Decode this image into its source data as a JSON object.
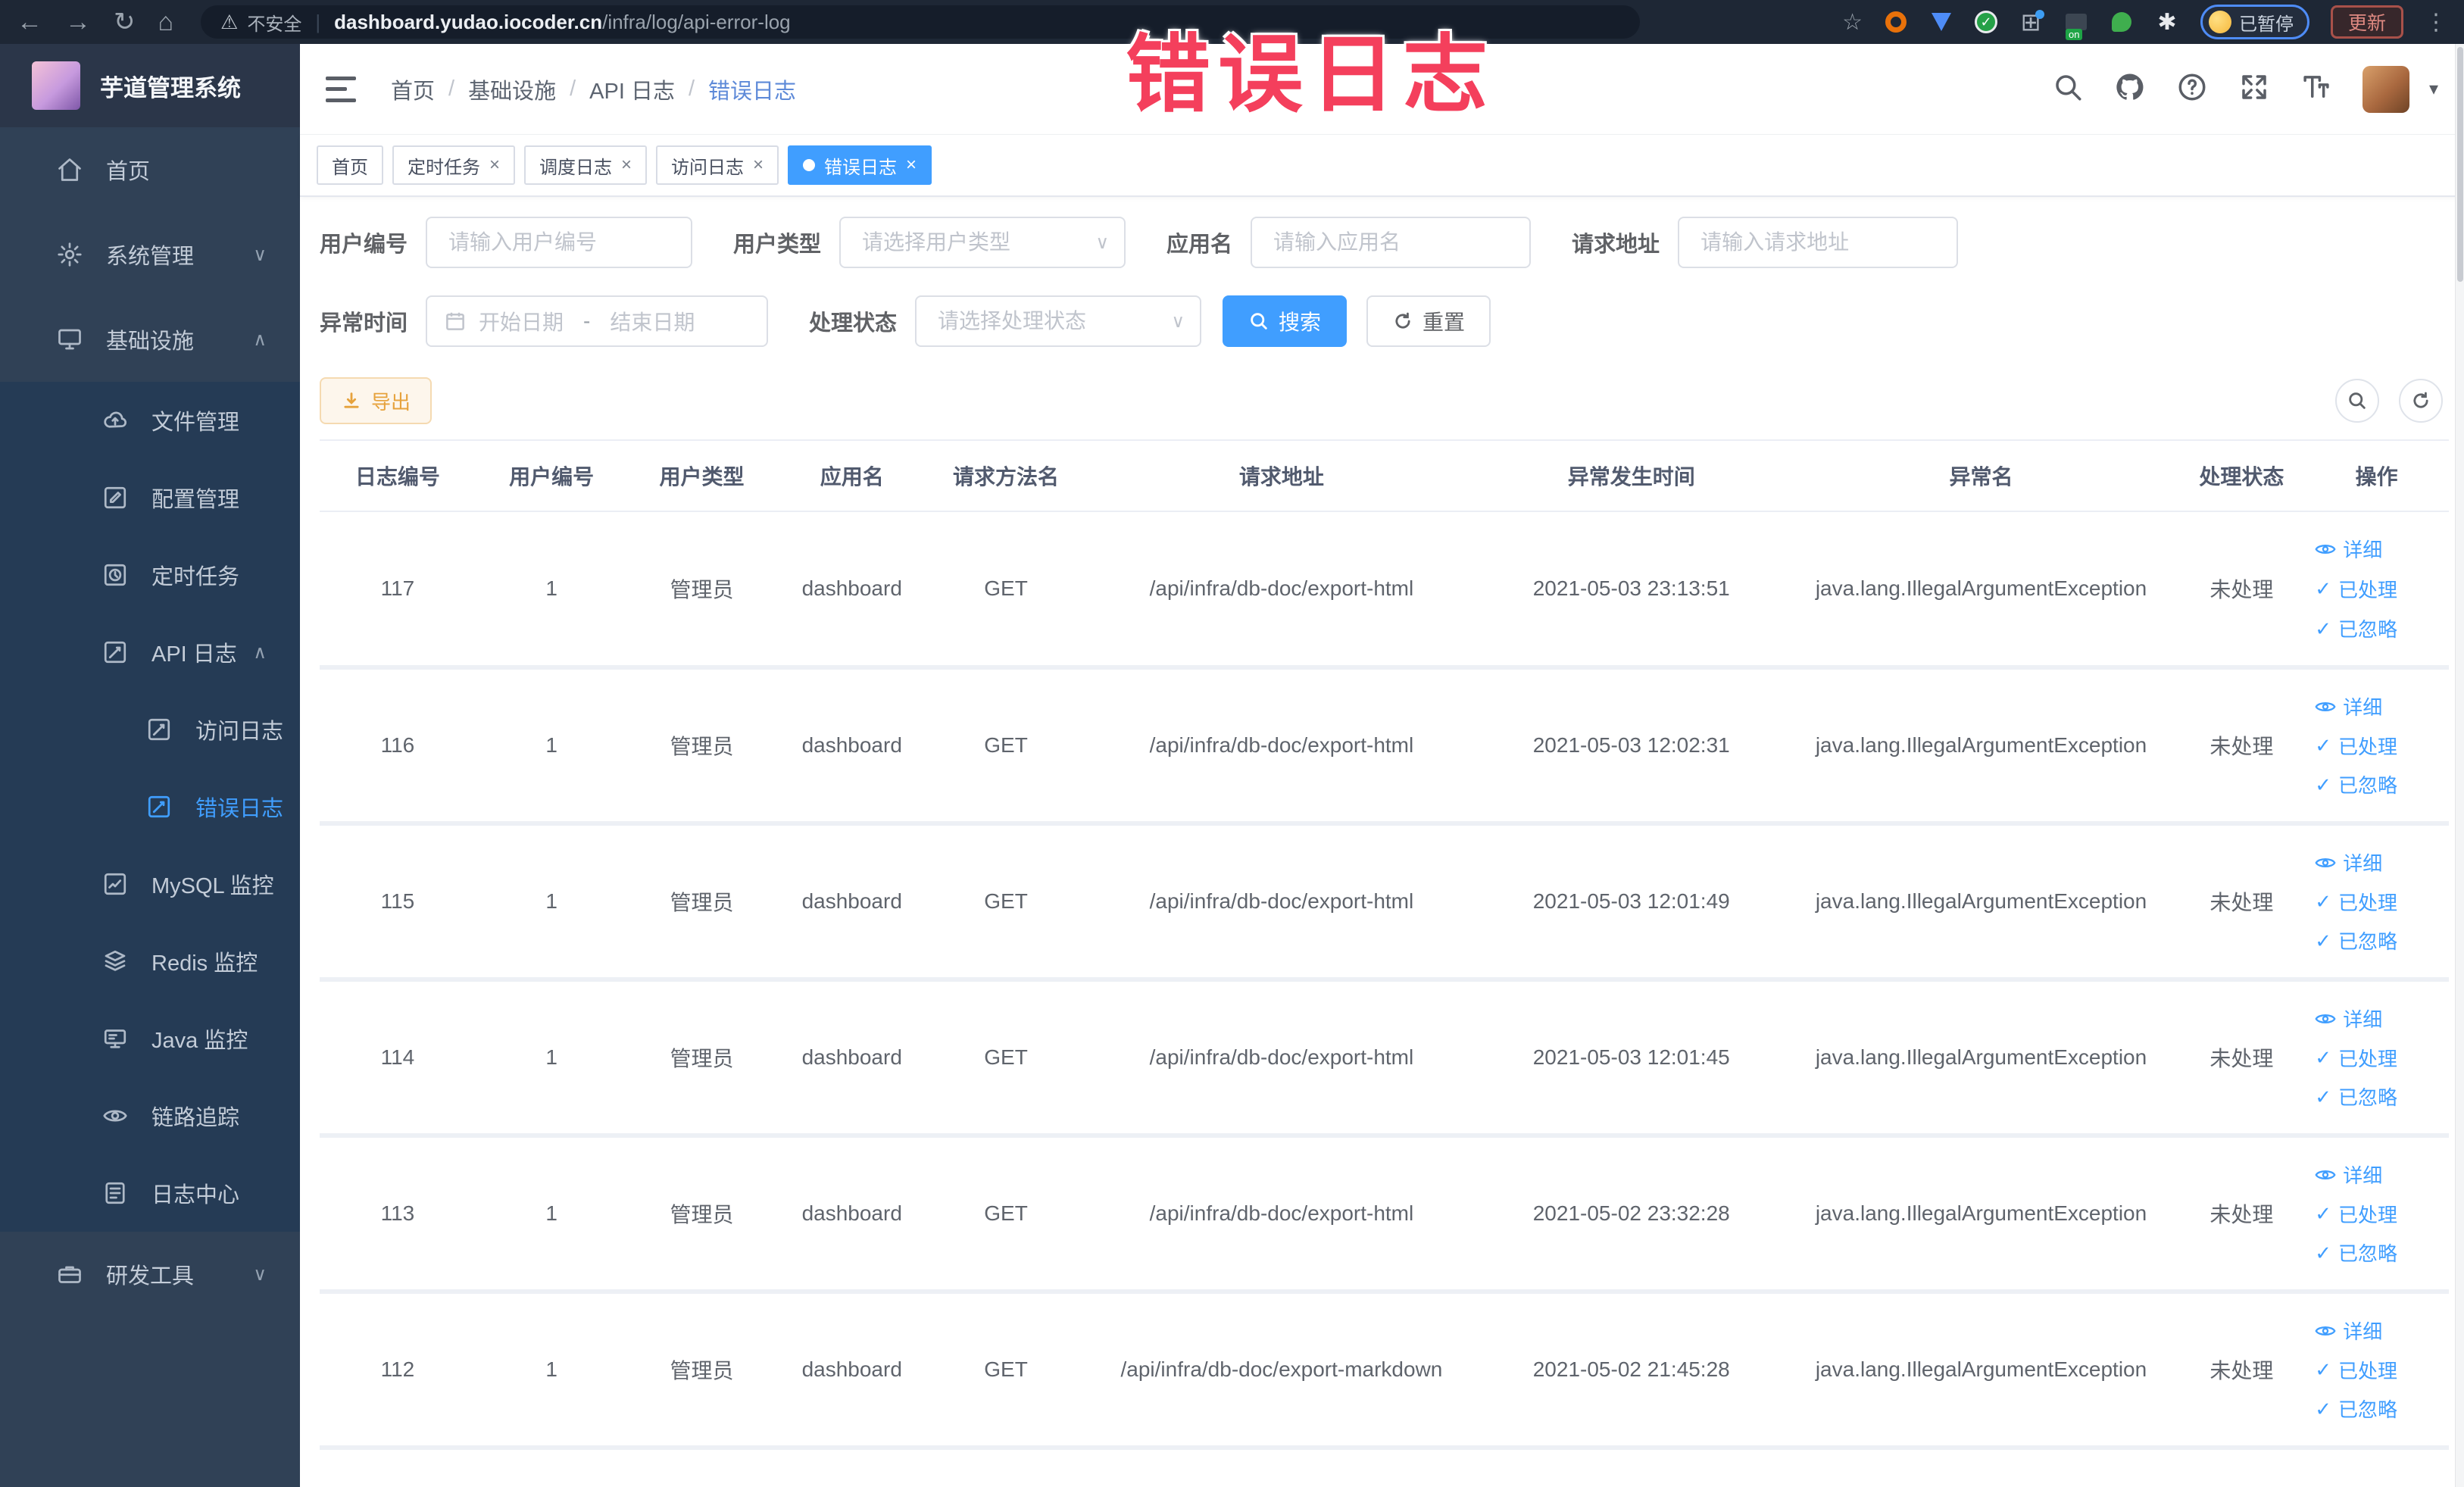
{
  "colors": {
    "accent": "#409eff",
    "warning": "#e6a23c",
    "watermark_pink": "#f43f5c",
    "sidebar_bg": "#304156",
    "submenu_bg": "#253b55",
    "chrome_bg": "#1e2735",
    "active_tab_bg": "#409eff"
  },
  "watermark_text": "错误日志",
  "browser": {
    "security_label": "不安全",
    "url_host": "dashboard.yudao.iocoder.cn",
    "url_path": "/infra/log/api-error-log",
    "on_badge": "on",
    "paused_label": "已暂停",
    "update_label": "更新"
  },
  "icons": {
    "back": "←",
    "forward": "→",
    "reload": "↻",
    "home": "⌂",
    "warning": "⚠",
    "divider": "|",
    "star": "☆",
    "grid": "⊞",
    "sparkle": "✱",
    "dots": "⋮",
    "check": "✓",
    "close": "×",
    "chevron_down": "∨",
    "chevron_up": "∧",
    "caret_down": "▾",
    "date_separator": "-"
  },
  "sidebar": {
    "title": "芋道管理系统",
    "home": "首页",
    "system": "系统管理",
    "infra": "基础设施",
    "file": "文件管理",
    "config": "配置管理",
    "job": "定时任务",
    "api_log": "API 日志",
    "access_log": "访问日志",
    "error_log": "错误日志",
    "mysql": "MySQL 监控",
    "redis": "Redis 监控",
    "java": "Java 监控",
    "trace": "链路追踪",
    "log_center": "日志中心",
    "devtools": "研发工具"
  },
  "breadcrumb": {
    "item1": "首页",
    "item2": "基础设施",
    "item3": "API 日志",
    "item4": "错误日志"
  },
  "tabs": {
    "tab1": "首页",
    "tab2": "定时任务",
    "tab3": "调度日志",
    "tab4": "访问日志",
    "tab5": "错误日志"
  },
  "filters": {
    "user_id_label": "用户编号",
    "user_id_placeholder": "请输入用户编号",
    "user_type_label": "用户类型",
    "user_type_placeholder": "请选择用户类型",
    "app_name_label": "应用名",
    "app_name_placeholder": "请输入应用名",
    "request_url_label": "请求地址",
    "request_url_placeholder": "请输入请求地址",
    "time_label": "异常时间",
    "time_start_placeholder": "开始日期",
    "time_end_placeholder": "结束日期",
    "status_label": "处理状态",
    "status_placeholder": "请选择处理状态",
    "search_label": "搜索",
    "reset_label": "重置"
  },
  "toolbar": {
    "export_label": "导出"
  },
  "table": {
    "headers": [
      "日志编号",
      "用户编号",
      "用户类型",
      "应用名",
      "请求方法名",
      "请求地址",
      "异常发生时间",
      "异常名",
      "处理状态",
      "操作"
    ],
    "actions": {
      "detail": "详细",
      "processed": "已处理",
      "ignored": "已忽略"
    },
    "rows": [
      {
        "log_id": "117",
        "user_id": "1",
        "user_type": "管理员",
        "app_name": "dashboard",
        "method": "GET",
        "url": "/api/infra/db-doc/export-html",
        "time": "2021-05-03 23:13:51",
        "exception": "java.lang.IllegalArgumentException",
        "status": "未处理"
      },
      {
        "log_id": "116",
        "user_id": "1",
        "user_type": "管理员",
        "app_name": "dashboard",
        "method": "GET",
        "url": "/api/infra/db-doc/export-html",
        "time": "2021-05-03 12:02:31",
        "exception": "java.lang.IllegalArgumentException",
        "status": "未处理"
      },
      {
        "log_id": "115",
        "user_id": "1",
        "user_type": "管理员",
        "app_name": "dashboard",
        "method": "GET",
        "url": "/api/infra/db-doc/export-html",
        "time": "2021-05-03 12:01:49",
        "exception": "java.lang.IllegalArgumentException",
        "status": "未处理"
      },
      {
        "log_id": "114",
        "user_id": "1",
        "user_type": "管理员",
        "app_name": "dashboard",
        "method": "GET",
        "url": "/api/infra/db-doc/export-html",
        "time": "2021-05-03 12:01:45",
        "exception": "java.lang.IllegalArgumentException",
        "status": "未处理"
      },
      {
        "log_id": "113",
        "user_id": "1",
        "user_type": "管理员",
        "app_name": "dashboard",
        "method": "GET",
        "url": "/api/infra/db-doc/export-html",
        "time": "2021-05-02 23:32:28",
        "exception": "java.lang.IllegalArgumentException",
        "status": "未处理"
      },
      {
        "log_id": "112",
        "user_id": "1",
        "user_type": "管理员",
        "app_name": "dashboard",
        "method": "GET",
        "url": "/api/infra/db-doc/export-markdown",
        "time": "2021-05-02 21:45:28",
        "exception": "java.lang.IllegalArgumentException",
        "status": "未处理"
      }
    ]
  }
}
